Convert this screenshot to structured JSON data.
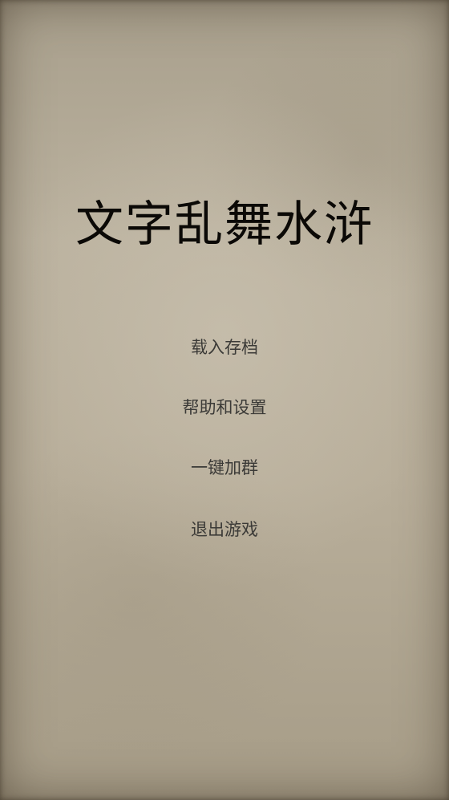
{
  "title": "文字乱舞水浒",
  "menu": {
    "items": [
      {
        "label": "载入存档"
      },
      {
        "label": "帮助和设置"
      },
      {
        "label": "一键加群"
      },
      {
        "label": "退出游戏"
      }
    ]
  },
  "colors": {
    "title": "#0b0906",
    "menu_text": "#3b3a37",
    "paper": "#b3a995"
  }
}
